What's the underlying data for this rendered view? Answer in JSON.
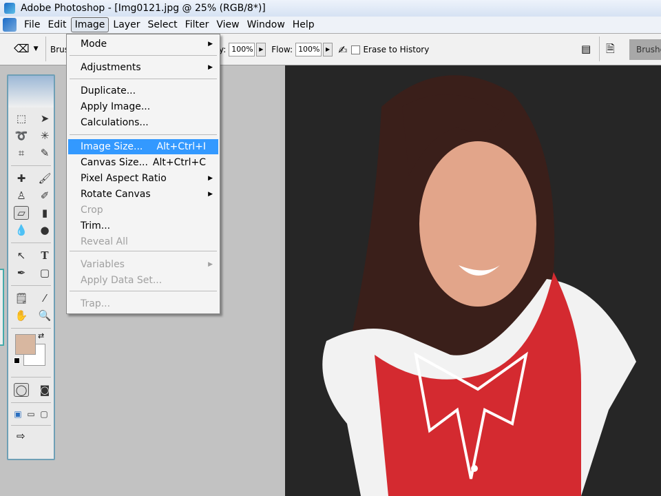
{
  "title": "Adobe Photoshop - [Img0121.jpg @ 25% (RGB/8*)]",
  "menubar": [
    "File",
    "Edit",
    "Image",
    "Layer",
    "Select",
    "Filter",
    "View",
    "Window",
    "Help"
  ],
  "options": {
    "brush_label": "Brus",
    "opacity_label": "y:",
    "opacity": "100%",
    "flow_label": "Flow:",
    "flow": "100%",
    "erase_to_history": "Erase to History",
    "erase_to_history_checked": false,
    "palette_tab": "Brushe"
  },
  "image_menu": {
    "items": [
      {
        "label": "Mode",
        "submenu": true
      },
      {
        "label": "Adjustments",
        "submenu": true
      },
      {
        "label": "Duplicate..."
      },
      {
        "label": "Apply Image..."
      },
      {
        "label": "Calculations..."
      },
      {
        "label": "Image Size...",
        "shortcut": "Alt+Ctrl+I",
        "highlighted": true
      },
      {
        "label": "Canvas Size...",
        "shortcut": "Alt+Ctrl+C"
      },
      {
        "label": "Pixel Aspect Ratio",
        "submenu": true
      },
      {
        "label": "Rotate Canvas",
        "submenu": true
      },
      {
        "label": "Crop",
        "disabled": true
      },
      {
        "label": "Trim..."
      },
      {
        "label": "Reveal All",
        "disabled": true
      },
      {
        "label": "Variables",
        "submenu": true,
        "disabled": true
      },
      {
        "label": "Apply Data Set...",
        "disabled": true
      },
      {
        "label": "Trap...",
        "disabled": true
      }
    ]
  },
  "colors": {
    "foreground": "#d8b7a0",
    "background": "#ffffff",
    "highlight": "#3399ff"
  }
}
